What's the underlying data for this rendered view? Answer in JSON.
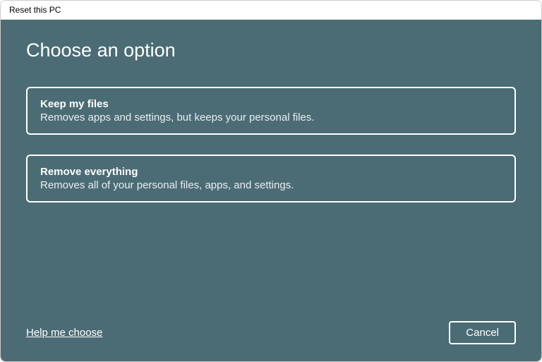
{
  "window": {
    "title": "Reset this PC"
  },
  "main": {
    "heading": "Choose an option",
    "options": [
      {
        "title": "Keep my files",
        "description": "Removes apps and settings, but keeps your personal files."
      },
      {
        "title": "Remove everything",
        "description": "Removes all of your personal files, apps, and settings."
      }
    ]
  },
  "footer": {
    "help_link": "Help me choose",
    "cancel_label": "Cancel"
  }
}
